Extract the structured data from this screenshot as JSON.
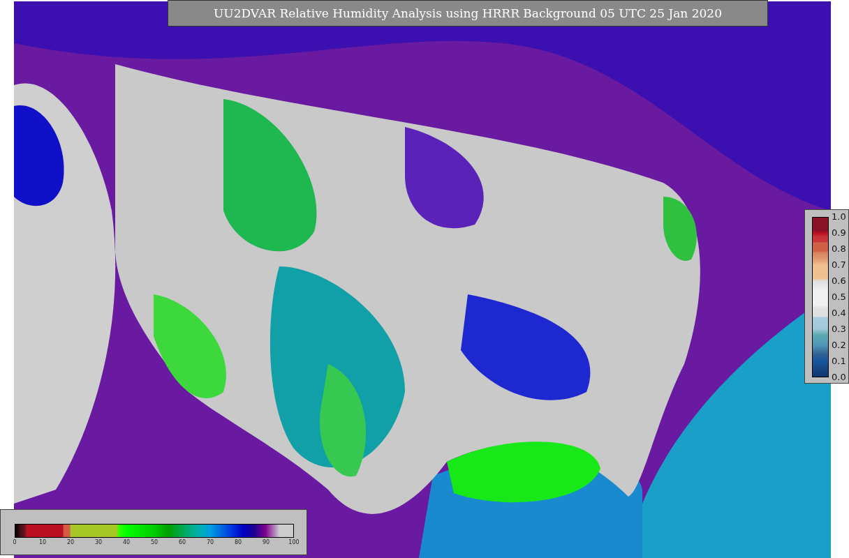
{
  "title": "UU2DVAR Relative Humidity Analysis using HRRR Background 05 UTC 25 Jan 2020",
  "horizontal_colorbar": {
    "ticks": [
      "0",
      "10",
      "20",
      "30",
      "40",
      "50",
      "60",
      "70",
      "80",
      "90",
      "100"
    ]
  },
  "vertical_colorbar": {
    "ticks": [
      "1.0",
      "0.9",
      "0.8",
      "0.7",
      "0.6",
      "0.5",
      "0.4",
      "0.3",
      "0.2",
      "0.1",
      "0.0"
    ]
  }
}
